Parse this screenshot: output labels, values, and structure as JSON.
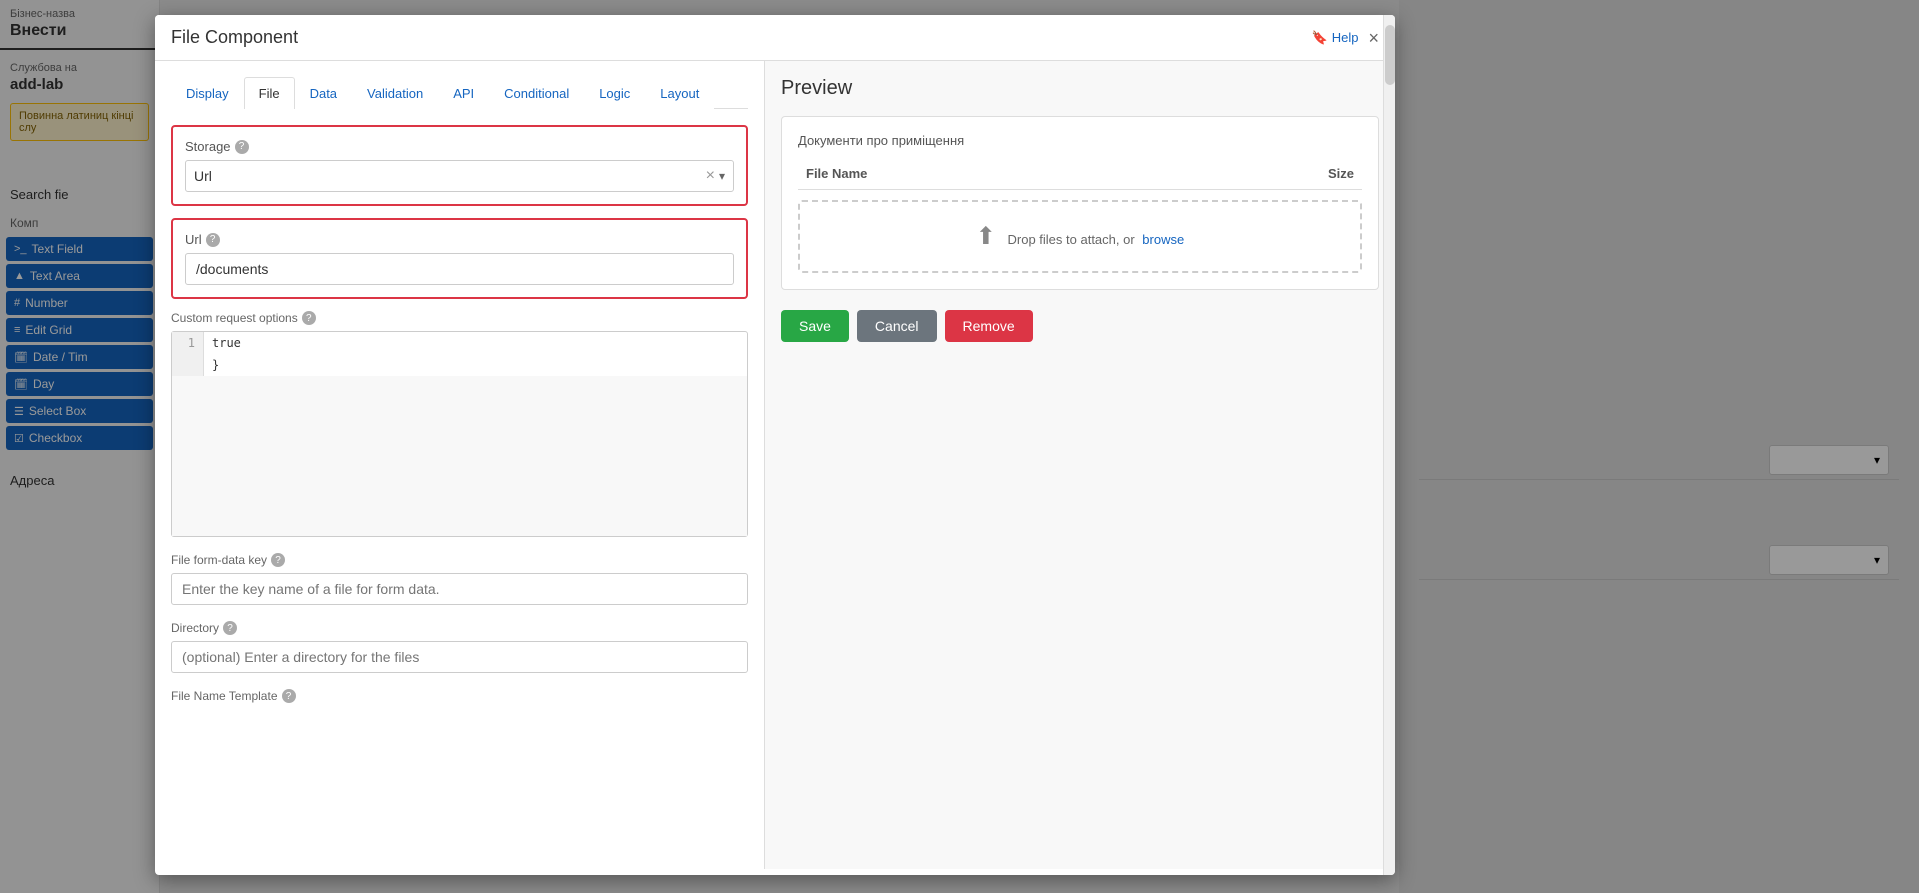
{
  "page": {
    "background_color": "#b0b0b0"
  },
  "sidebar": {
    "business_name_label": "Бізнес-назва",
    "business_name_value": "Внести",
    "service_label": "Службова на",
    "service_value": "add-lab",
    "warning_text": "Повинна латиниц кінці слу",
    "search_label": "Search fie",
    "components_label": "Комп",
    "components": [
      {
        "icon": ">_",
        "label": "Text Field"
      },
      {
        "icon": "A",
        "label": "Text Area"
      },
      {
        "icon": "#",
        "label": "Number"
      },
      {
        "icon": "≡",
        "label": "Edit Grid"
      },
      {
        "icon": "📅",
        "label": "Date / Tim"
      },
      {
        "icon": "📅",
        "label": "Day"
      },
      {
        "icon": "☰",
        "label": "Select Box"
      },
      {
        "icon": "☑",
        "label": "Checkbox"
      }
    ],
    "bottom_label": "Адреса"
  },
  "modal": {
    "title": "File Component",
    "help_label": "Help",
    "close_label": "×",
    "tabs": [
      {
        "id": "display",
        "label": "Display"
      },
      {
        "id": "file",
        "label": "File",
        "active": true
      },
      {
        "id": "data",
        "label": "Data"
      },
      {
        "id": "validation",
        "label": "Validation"
      },
      {
        "id": "api",
        "label": "API"
      },
      {
        "id": "conditional",
        "label": "Conditional"
      },
      {
        "id": "logic",
        "label": "Logic"
      },
      {
        "id": "layout",
        "label": "Layout"
      }
    ],
    "storage_label": "Storage",
    "storage_value": "Url",
    "storage_clear": "×",
    "storage_arrow": "▾",
    "url_label": "Url",
    "url_value": "/documents",
    "custom_request_label": "Custom request options",
    "code_line_num": "1",
    "code_content": "    true\n    }",
    "file_form_data_key_label": "File form-data key",
    "file_form_data_key_placeholder": "Enter the key name of a file for form data.",
    "directory_label": "Directory",
    "directory_placeholder": "(optional) Enter a directory for the files",
    "file_name_template_label": "File Name Template"
  },
  "preview": {
    "title": "Preview",
    "field_label": "Документи про приміщення",
    "table_headers": {
      "file_name": "File Name",
      "size": "Size"
    },
    "drop_text": "Drop files to attach, or",
    "browse_text": "browse",
    "buttons": {
      "save": "Save",
      "cancel": "Cancel",
      "remove": "Remove"
    }
  }
}
